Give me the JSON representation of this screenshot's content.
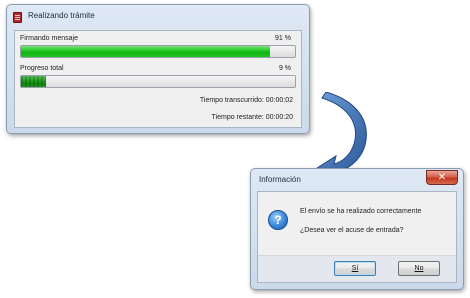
{
  "progress_window": {
    "title": "Realizando trámite",
    "rows": [
      {
        "label": "Firmando mensaje",
        "percent_text": "91 %",
        "progress": 0.91
      },
      {
        "label": "Progreso total",
        "percent_text": "9 %",
        "progress": 0.09
      }
    ],
    "elapsed_label": "Tiempo transcurrido: 00:00:02",
    "remaining_label": "Tiempo restante: 00:00:20"
  },
  "dialog": {
    "title": "Información",
    "close_symbol": "✕",
    "icon": "question-icon",
    "icon_symbol": "?",
    "message_line1": "El envío se ha realizado correctamente",
    "message_line2": "¿Desea ver el acuse de entrada?",
    "yes_label": "Sí",
    "no_label": "No"
  },
  "colors": {
    "progress_green": "#12b412",
    "arrow_blue": "#2f5f9f",
    "close_red": "#c23a22"
  }
}
